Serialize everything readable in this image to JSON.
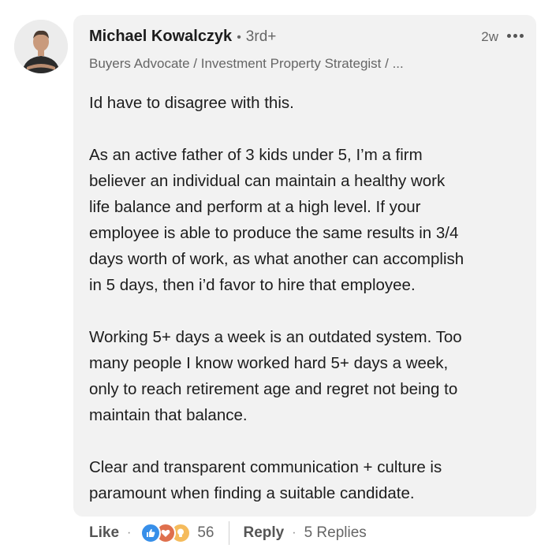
{
  "comment": {
    "author": {
      "name": "Michael Kowalczyk",
      "degree": "3rd+",
      "headline": "Buyers Advocate / Investment Property Strategist / ..."
    },
    "separator": "•",
    "timestamp": "2w",
    "more_icon": "more-horizontal-icon",
    "paragraphs": [
      [
        "Id have to disagree with this."
      ],
      [
        "As an active father of 3 kids under 5, I’m a firm",
        "believer an individual can maintain a healthy work",
        "life balance and perform at a high level. If your",
        "employee is able to produce the same results in 3/4",
        "days worth of work, as what another can accomplish",
        "in 5 days, then i’d favor to hire that employee."
      ],
      [
        "Working 5+ days a week is an outdated system. Too",
        "many people I know worked hard 5+ days a week,",
        "only to reach retirement age and regret not being to",
        "maintain that balance."
      ],
      [
        "Clear and transparent communication + culture is",
        "paramount when finding a suitable candidate."
      ]
    ]
  },
  "actions": {
    "like_label": "Like",
    "dot": "·",
    "reactions": {
      "icons": [
        "like-reaction-icon",
        "love-reaction-icon",
        "insightful-reaction-icon"
      ],
      "count": "56"
    },
    "reply_label": "Reply",
    "replies_label": "5 Replies"
  },
  "colors": {
    "card_bg": "#f2f2f2",
    "like_blue": "#378fe9",
    "love_orange": "#df704d",
    "insight_yellow": "#f5bb5c"
  }
}
